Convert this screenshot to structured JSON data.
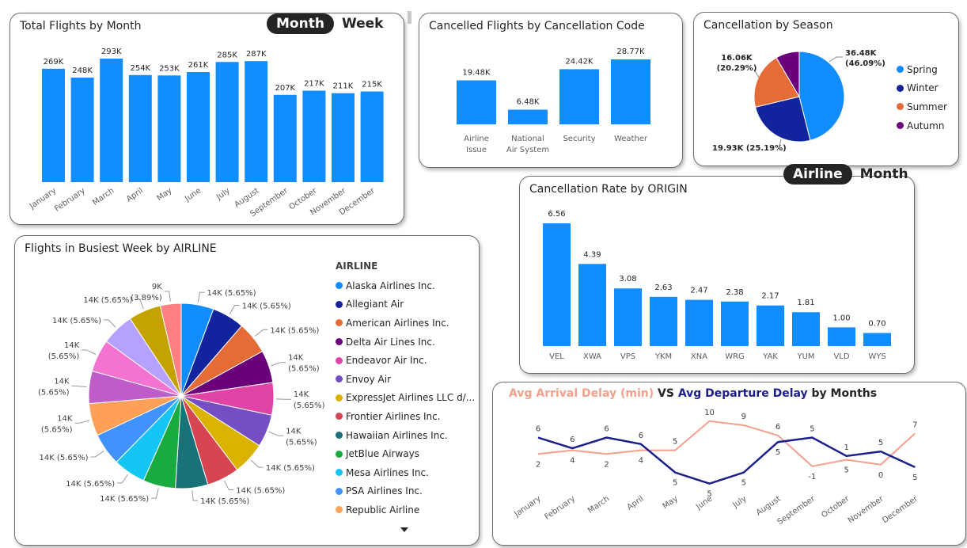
{
  "palette": {
    "bar": "#118DFF",
    "text": "#252423",
    "axis": "#605E5C",
    "spring": "#118DFF",
    "winter": "#12239E",
    "summer": "#E66C37",
    "autumn": "#6B007B",
    "arrival": "#F4A08C",
    "departure": "#1B1F8C"
  },
  "monthly": {
    "title": "Total Flights by Month",
    "toggle": {
      "active": "Month",
      "inactive": "Week"
    }
  },
  "codes": {
    "title": "Cancelled Flights by Cancellation Code"
  },
  "season": {
    "title": "Cancellation by Season"
  },
  "origin": {
    "title": "Cancellation Rate by ORIGIN",
    "toggle": {
      "active": "Airline",
      "inactive": "Month"
    }
  },
  "busiest": {
    "title": "Flights in Busiest Week by AIRLINE",
    "legend_title": "AIRLINE",
    "legend": [
      {
        "name": "Alaska Airlines Inc.",
        "color": "#118DFF"
      },
      {
        "name": "Allegiant Air",
        "color": "#12239E"
      },
      {
        "name": "American Airlines Inc.",
        "color": "#E66C37"
      },
      {
        "name": "Delta Air Lines Inc.",
        "color": "#6B007B"
      },
      {
        "name": "Endeavor Air Inc.",
        "color": "#E044A7"
      },
      {
        "name": "Envoy Air",
        "color": "#744EC2"
      },
      {
        "name": "ExpressJet Airlines LLC d/...",
        "color": "#D9B300"
      },
      {
        "name": "Frontier Airlines Inc.",
        "color": "#D64550"
      },
      {
        "name": "Hawaiian Airlines Inc.",
        "color": "#197278"
      },
      {
        "name": "JetBlue Airways",
        "color": "#1AAB40"
      },
      {
        "name": "Mesa Airlines Inc.",
        "color": "#15C6F4"
      },
      {
        "name": "PSA Airlines Inc.",
        "color": "#4092FF"
      },
      {
        "name": "Republic Airline",
        "color": "#FFA058"
      }
    ]
  },
  "combo": {
    "title_parts": [
      "Avg Arrival Delay (min)",
      " VS ",
      "Avg Departure Delay",
      " by Months"
    ]
  },
  "chart_data": [
    {
      "id": "monthly",
      "type": "bar",
      "title": "Total Flights by Month",
      "categories": [
        "January",
        "February",
        "March",
        "April",
        "May",
        "June",
        "July",
        "August",
        "September",
        "October",
        "November",
        "December"
      ],
      "values": [
        269000,
        248000,
        293000,
        254000,
        253000,
        261000,
        285000,
        287000,
        207000,
        217000,
        211000,
        215000
      ],
      "labels": [
        "269K",
        "248K",
        "293K",
        "254K",
        "253K",
        "261K",
        "285K",
        "287K",
        "207K",
        "217K",
        "211K",
        "215K"
      ],
      "ylim": [
        0,
        293000
      ]
    },
    {
      "id": "codes",
      "type": "bar",
      "title": "Cancelled Flights by Cancellation Code",
      "categories": [
        [
          "Airline",
          "Issue"
        ],
        [
          "National",
          "Air System"
        ],
        [
          "Security"
        ],
        [
          "Weather"
        ]
      ],
      "values": [
        19480,
        6480,
        24420,
        28770
      ],
      "labels": [
        "19.48K",
        "6.48K",
        "24.42K",
        "28.77K"
      ],
      "ylim": [
        0,
        28770
      ]
    },
    {
      "id": "season",
      "type": "pie",
      "title": "Cancellation by Season",
      "labels": [
        "Spring",
        "Winter",
        "Summer",
        "Autumn"
      ],
      "values": [
        36480,
        19930,
        16060,
        6700
      ],
      "value_labels": [
        "36.48K\n(46.09%)",
        "19.93K (25.19%)",
        "16.06K\n(20.29%)",
        ""
      ],
      "legend": "right"
    },
    {
      "id": "origin",
      "type": "bar",
      "title": "Cancellation Rate by ORIGIN",
      "categories": [
        "VEL",
        "XWA",
        "VPS",
        "YKM",
        "XNA",
        "WRG",
        "YAK",
        "YUM",
        "VLD",
        "WYS"
      ],
      "values": [
        6.56,
        4.39,
        3.08,
        2.63,
        2.47,
        2.38,
        2.17,
        1.81,
        1.0,
        0.7
      ],
      "labels": [
        "6.56",
        "4.39",
        "3.08",
        "2.63",
        "2.47",
        "2.38",
        "2.17",
        "1.81",
        "1.00",
        "0.70"
      ],
      "ylim": [
        0,
        6.56
      ]
    },
    {
      "id": "busiest",
      "type": "pie",
      "title": "Flights in Busiest Week by AIRLINE",
      "values": [
        14,
        14,
        14,
        14,
        14,
        14,
        14,
        14,
        14,
        14,
        14,
        14,
        14,
        14,
        14,
        14,
        14,
        9
      ],
      "slice_labels": [
        "14K (5.65%)",
        "14K (5.65%)",
        "14K (5.65%)",
        "14K\n(5.65%)",
        "14K\n(5.65%)",
        "14K\n(5.65%)",
        "14K (5.65%)",
        "14K (5.65%)",
        "14K (5.65%)",
        "14K (5.65%)",
        "14K (5.65%)",
        "14K (5.65%)",
        "14K\n(5.65%)",
        "14K\n(5.65%)",
        "14K\n(5.65%)",
        "14K (5.65%)",
        "14K (5.65%)",
        "9K\n(3.89%)"
      ],
      "colors": [
        "#118DFF",
        "#12239E",
        "#E66C37",
        "#6B007B",
        "#E044A7",
        "#744EC2",
        "#D9B300",
        "#D64550",
        "#197278",
        "#1AAB40",
        "#15C6F4",
        "#4092FF",
        "#FFA058",
        "#BE5DC9",
        "#F472D0",
        "#B5A1FF",
        "#C4A200",
        "#FF8080"
      ],
      "legend": "right"
    },
    {
      "id": "delays",
      "type": "line",
      "title": "Avg Arrival Delay (min) VS Avg Departure Delay by Months",
      "categories": [
        "January",
        "February",
        "March",
        "April",
        "May",
        "June",
        "July",
        "August",
        "September",
        "October",
        "November",
        "December"
      ],
      "series": [
        {
          "name": "Avg Arrival Delay (min)",
          "values": [
            2,
            4,
            2,
            4,
            5,
            10,
            9,
            6,
            -1,
            5,
            0,
            7
          ]
        },
        {
          "name": "Avg Departure Delay",
          "values": [
            6,
            6,
            6,
            6,
            5,
            5,
            5,
            5,
            5,
            1,
            5,
            5
          ]
        }
      ],
      "series_plot": [
        [
          2,
          2.9,
          2,
          2.9,
          2.9,
          10,
          9,
          6.5,
          -1,
          0.6,
          -0.6,
          7
        ],
        [
          6,
          3.4,
          6,
          4.4,
          -2.5,
          -5.2,
          -2.5,
          4.9,
          6,
          1.5,
          2.6,
          -1.2
        ]
      ],
      "ylim": [
        -7,
        14
      ]
    }
  ]
}
